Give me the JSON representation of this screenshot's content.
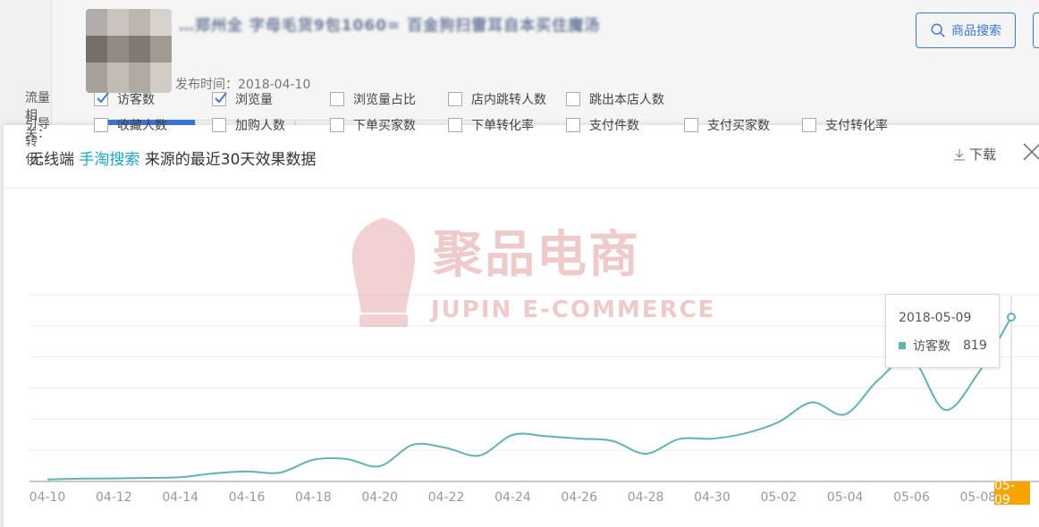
{
  "background": {
    "title_blurred": "…郑州全 字母毛货9包1060= 百金狗扫雷耳自本买住魔汤",
    "publish_label": "发布时间：2018-04-10",
    "search_button": "商品搜索"
  },
  "modal": {
    "title_prefix": "无线端",
    "title_source": "手淘搜索",
    "title_suffix": "来源的最近30天效果数据",
    "download_label": "下载"
  },
  "filters": {
    "row1_label": "流量相关：",
    "row1": [
      {
        "label": "访客数",
        "checked": true
      },
      {
        "label": "浏览量",
        "checked": true
      },
      {
        "label": "浏览量占比",
        "checked": false
      },
      {
        "label": "店内跳转人数",
        "checked": false
      },
      {
        "label": "跳出本店人数",
        "checked": false
      }
    ],
    "row2_label": "引导转化：",
    "row2": [
      {
        "label": "收藏人数",
        "checked": false
      },
      {
        "label": "加购人数",
        "checked": false
      },
      {
        "label": "下单买家数",
        "checked": false
      },
      {
        "label": "下单转化率",
        "checked": false
      },
      {
        "label": "支付件数",
        "checked": false
      },
      {
        "label": "支付买家数",
        "checked": false
      },
      {
        "label": "支付转化率",
        "checked": false
      }
    ]
  },
  "watermark": {
    "cn": "聚品电商",
    "en": "JUPIN E-COMMERCE"
  },
  "tooltip": {
    "date": "2018-05-09",
    "series": "访客数",
    "value": "819"
  },
  "colors": {
    "line": "#5fb3b3",
    "highlight": "#1aa6c9",
    "x_highlight_bg": "#f7a300"
  },
  "chart_data": {
    "type": "line",
    "x": [
      "04-10",
      "04-11",
      "04-12",
      "04-13",
      "04-14",
      "04-15",
      "04-16",
      "04-17",
      "04-18",
      "04-19",
      "04-20",
      "04-21",
      "04-22",
      "04-23",
      "04-24",
      "04-25",
      "04-26",
      "04-27",
      "04-28",
      "04-29",
      "04-30",
      "05-01",
      "05-02",
      "05-03",
      "05-04",
      "05-05",
      "05-06",
      "05-07",
      "05-08",
      "05-09"
    ],
    "x_tick_labels": [
      "04-10",
      "04-12",
      "04-14",
      "04-16",
      "04-18",
      "04-20",
      "04-22",
      "04-24",
      "04-26",
      "04-28",
      "04-30",
      "05-02",
      "05-04",
      "05-06",
      "05-08",
      "05-09"
    ],
    "series": [
      {
        "name": "访客数",
        "values": [
          10,
          14,
          15,
          18,
          21,
          40,
          50,
          44,
          108,
          112,
          76,
          183,
          167,
          129,
          232,
          225,
          213,
          202,
          138,
          211,
          213,
          240,
          296,
          394,
          334,
          506,
          612,
          357,
          538,
          819
        ]
      }
    ],
    "ylim": [
      0,
      930
    ],
    "grid": true,
    "highlight_index": 29
  }
}
